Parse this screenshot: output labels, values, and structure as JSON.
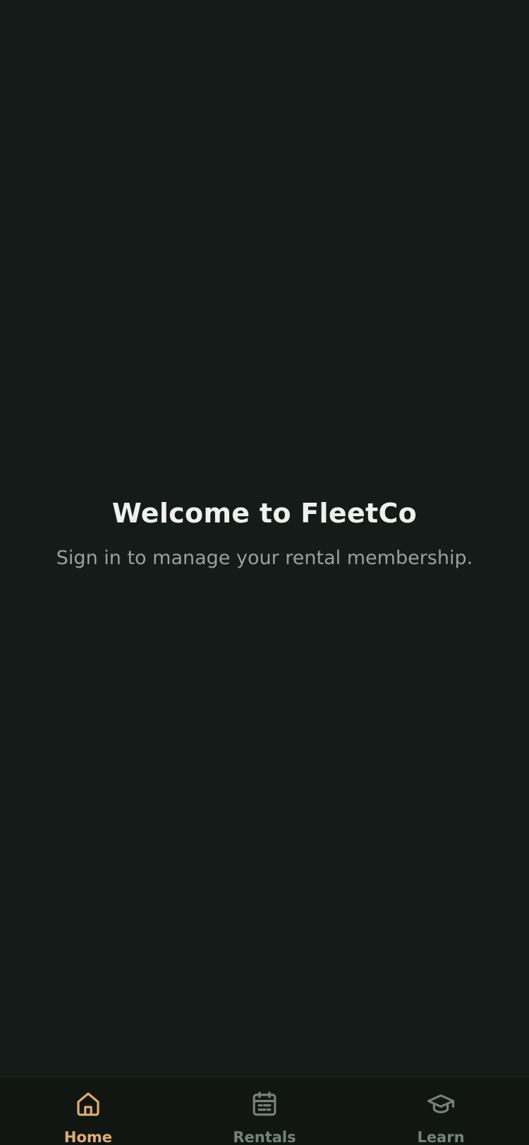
{
  "welcome": {
    "title": "Welcome to FleetCo",
    "subtitle": "Sign in to manage your rental membership."
  },
  "tabbar": {
    "tabs": [
      {
        "label": "Home",
        "icon": "home-icon",
        "active": true
      },
      {
        "label": "Rentals",
        "icon": "calendar-icon",
        "active": false
      },
      {
        "label": "Learn",
        "icon": "graduation-cap-icon",
        "active": false
      }
    ],
    "colors": {
      "active": "#e2ad72",
      "inactive": "#77827c"
    }
  },
  "colors": {
    "background": "#151b18",
    "tabbar_background": "#111613",
    "title": "#eef1ec",
    "subtitle": "#98a29c"
  }
}
